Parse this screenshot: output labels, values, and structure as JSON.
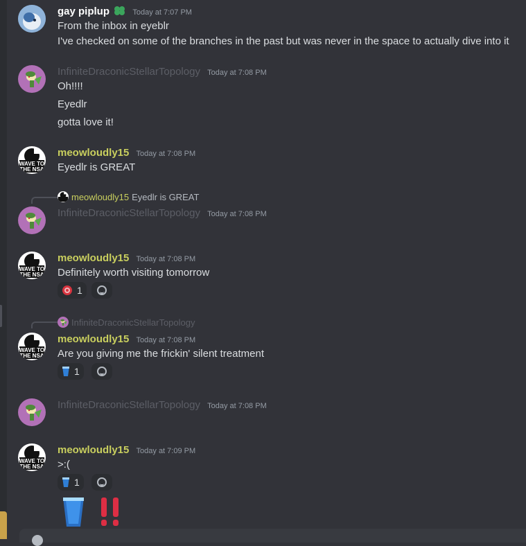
{
  "messages": {
    "m1": {
      "author": "gay piplup",
      "timestamp": "Today at 7:07 PM",
      "lines": [
        "From the inbox in eyeblr",
        "I've checked on some of the branches in the past but was never in the space to actually dive into it"
      ],
      "badge_icon": "clover-badge-icon"
    },
    "m2": {
      "author": "InfiniteDraconicStellarTopology",
      "timestamp": "Today at 7:08 PM",
      "lines": [
        "Oh!!!!",
        "Eyedlr",
        "gotta love it!"
      ]
    },
    "m3": {
      "author": "meowloudly15",
      "timestamp": "Today at 7:08 PM",
      "lines": [
        "Eyedlr is GREAT"
      ]
    },
    "m4": {
      "reply_author": "meowloudly15",
      "reply_text": "Eyedlr is GREAT",
      "author": "InfiniteDraconicStellarTopology",
      "timestamp": "Today at 7:08 PM"
    },
    "m5": {
      "author": "meowloudly15",
      "timestamp": "Today at 7:08 PM",
      "lines": [
        "Definitely worth visiting tomorrow"
      ],
      "reaction": {
        "emoji": "red-target-emoji",
        "count": "1"
      }
    },
    "m6": {
      "reply_author": "InfiniteDraconicStellarTopology",
      "author": "meowloudly15",
      "timestamp": "Today at 7:08 PM",
      "lines": [
        "Are you giving me the frickin' silent treatment"
      ],
      "reaction": {
        "emoji": "blue-cup-emoji",
        "count": "1"
      }
    },
    "m7": {
      "author": "InfiniteDraconicStellarTopology",
      "timestamp": "Today at 7:08 PM"
    },
    "m8": {
      "author": "meowloudly15",
      "timestamp": "Today at 7:09 PM",
      "lines": [
        ">:("
      ],
      "reaction": {
        "emoji": "blue-cup-emoji",
        "count": "1"
      },
      "big_emojis": [
        "blue-cup-emoji",
        "double-exclamation-emoji"
      ]
    }
  },
  "avatar_text": {
    "nsa_line1": "WAVE TO",
    "nsa_line2": "THE NSA"
  },
  "colors": {
    "background": "#323339",
    "username_yellow": "#c9cf5e",
    "faded_name": "#5c5e66",
    "timestamp": "#949ba4",
    "text": "#dbdee1",
    "reaction_bg": "#2b2d31"
  }
}
